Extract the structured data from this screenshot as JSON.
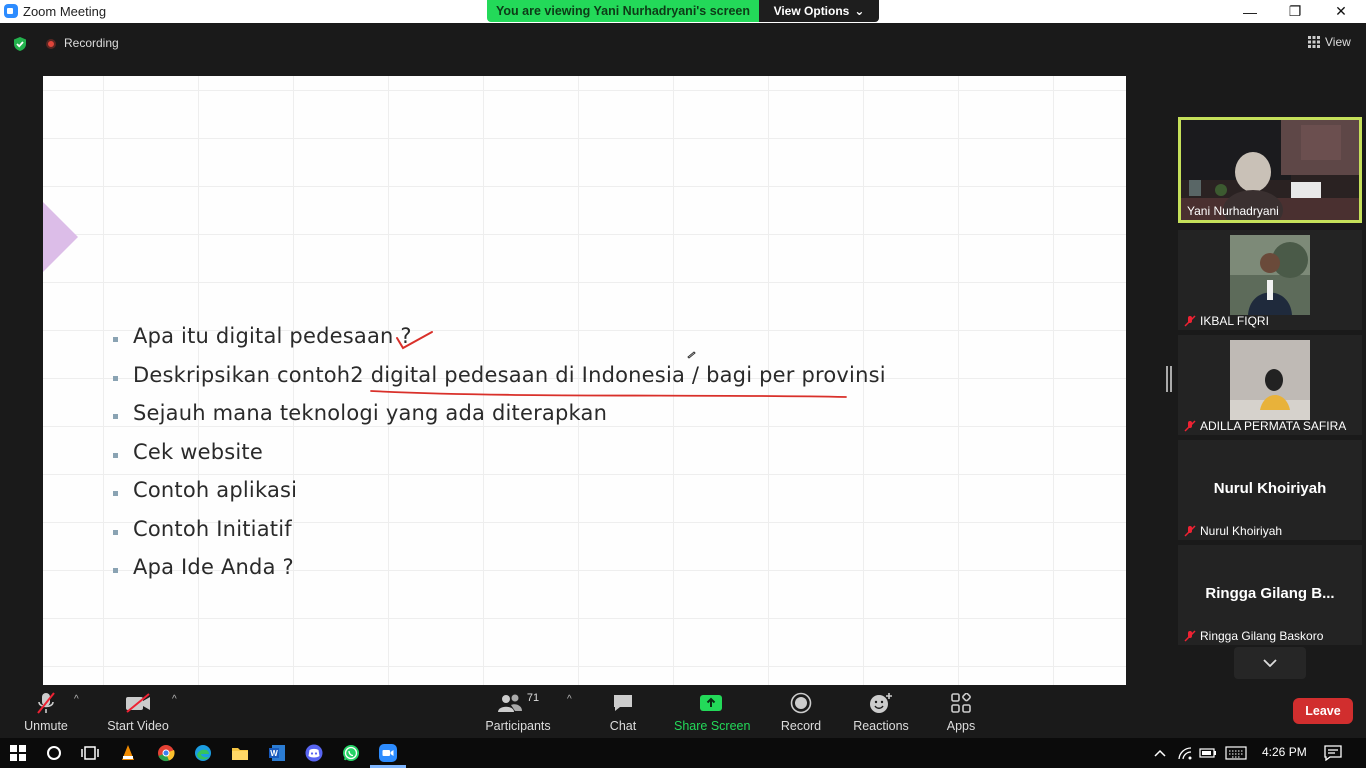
{
  "window": {
    "title": "Zoom Meeting",
    "minimize": "—",
    "restore": "❐",
    "close": "✕"
  },
  "banner": {
    "viewing": "You are viewing Yani Nurhadryani's screen",
    "view_options": "View Options",
    "view_options_caret": "⌄"
  },
  "topbar": {
    "recording_label": "Recording",
    "view_label": "View"
  },
  "slide": {
    "bullets": [
      "Apa itu digital pedesaan ?",
      "Deskripsikan contoh2 digital pedesaan di Indonesia / bagi per provinsi",
      "Sejauh mana teknologi yang ada diterapkan",
      "Cek website",
      "Contoh aplikasi",
      "Contoh Initiatif",
      "Apa Ide Anda ?"
    ],
    "annotation_color": "#d9302a",
    "accent_color": "#dcbde8"
  },
  "gallery": {
    "participants": [
      {
        "name": "Yani Nurhadryani",
        "active": true,
        "muted": false,
        "video": true
      },
      {
        "name": "IKBAL FIQRI",
        "active": false,
        "muted": true,
        "video": true
      },
      {
        "name": "ADILLA PERMATA SAFIRA",
        "active": false,
        "muted": true,
        "video": true
      },
      {
        "name": "Nurul Khoiriyah",
        "display": "Nurul Khoiriyah",
        "active": false,
        "muted": true,
        "video": false
      },
      {
        "name": "Ringga Gilang Baskoro",
        "display": "Ringga Gilang B...",
        "active": false,
        "muted": true,
        "video": false
      }
    ],
    "active_border_color": "#c5e05a"
  },
  "toolbar": {
    "unmute": "Unmute",
    "start_video": "Start Video",
    "participants": "Participants",
    "participants_count": "71",
    "chat": "Chat",
    "share_screen": "Share Screen",
    "record": "Record",
    "reactions": "Reactions",
    "apps": "Apps",
    "leave": "Leave",
    "caret": "^",
    "share_color": "#23d959",
    "leave_color": "#d12e2e"
  },
  "taskbar": {
    "time": "4:26 PM"
  }
}
